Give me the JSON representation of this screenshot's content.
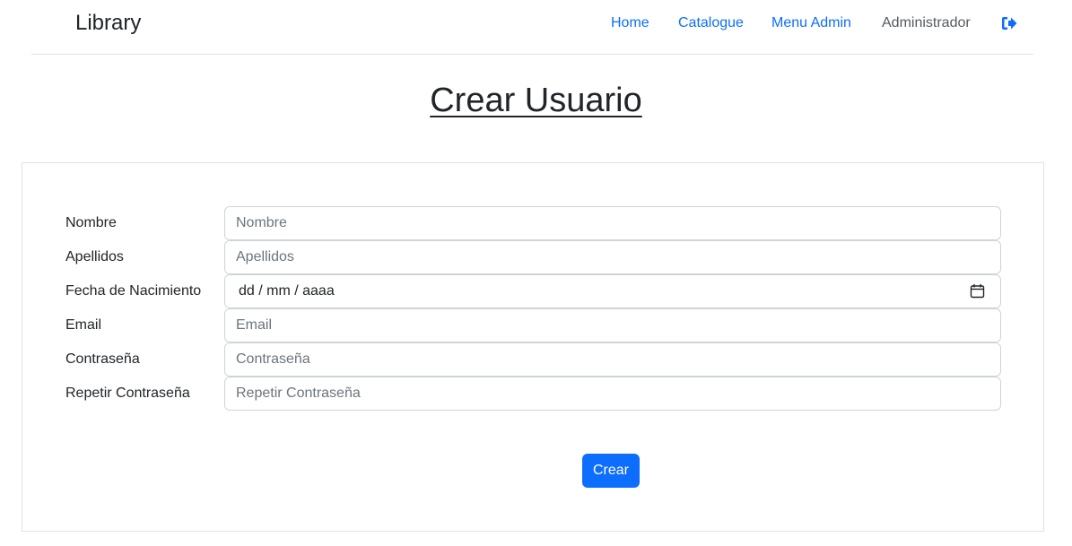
{
  "navbar": {
    "brand": "Library",
    "links": [
      {
        "label": "Home"
      },
      {
        "label": "Catalogue"
      },
      {
        "label": "Menu Admin"
      }
    ],
    "user": "Administrador",
    "logout_icon": "sign-out-icon"
  },
  "page": {
    "title": "Crear Usuario"
  },
  "form": {
    "fields": [
      {
        "label": "Nombre",
        "placeholder": "Nombre",
        "value": ""
      },
      {
        "label": "Apellidos",
        "placeholder": "Apellidos",
        "value": ""
      },
      {
        "label": "Fecha de Nacimiento",
        "display": "dd / mm / aaaa",
        "icon": "calendar-icon"
      },
      {
        "label": "Email",
        "placeholder": "Email",
        "value": ""
      },
      {
        "label": "Contraseña",
        "placeholder": "Contraseña",
        "value": ""
      },
      {
        "label": "Repetir Contraseña",
        "placeholder": "Repetir Contraseña",
        "value": ""
      }
    ],
    "submit_label": "Crear"
  },
  "colors": {
    "accent": "#0d6efd",
    "border": "#dee2e6",
    "text": "#212529",
    "muted": "#6c757d"
  }
}
